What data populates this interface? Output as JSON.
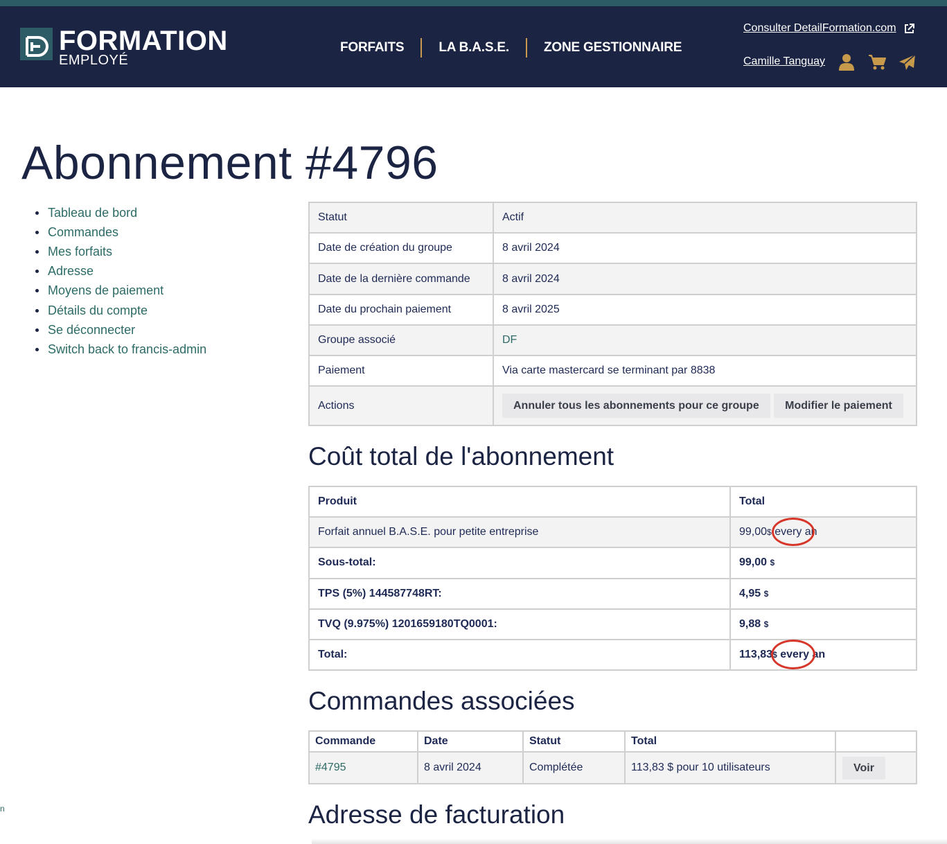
{
  "header": {
    "logo_title": "FORMATION",
    "logo_sub": "EMPLOYÉ",
    "nav": [
      "FORFAITS",
      "LA B.A.S.E.",
      "ZONE GESTIONNAIRE"
    ],
    "external_link": "Consulter DetailFormation.com",
    "user_name": "Camille Tanguay",
    "icons": [
      "user-icon",
      "cart-icon",
      "paper-plane-icon",
      "external-link-icon"
    ]
  },
  "page_title": "Abonnement #4796",
  "sidebar": {
    "items": [
      "Tableau de bord",
      "Commandes",
      "Mes forfaits",
      "Adresse",
      "Moyens de paiement",
      "Détails du compte",
      "Se déconnecter",
      "Switch back to francis-admin"
    ]
  },
  "subscription": {
    "rows": [
      {
        "label": "Statut",
        "value": "Actif"
      },
      {
        "label": "Date de création du groupe",
        "value": "8 avril 2024"
      },
      {
        "label": "Date de la dernière commande",
        "value": "8 avril 2024"
      },
      {
        "label": "Date du prochain paiement",
        "value": "8 avril 2025"
      },
      {
        "label": "Groupe associé",
        "value": "DF"
      },
      {
        "label": "Paiement",
        "value": "Via carte mastercard se terminant par 8838"
      }
    ],
    "actions_label": "Actions",
    "cancel_button": "Annuler tous les abonnements pour ce groupe",
    "modify_button": "Modifier le paiement"
  },
  "cost": {
    "heading": "Coût total de l'abonnement",
    "col_product": "Produit",
    "col_total": "Total",
    "product_name": "Forfait annuel B.A.S.E. pour petite entreprise",
    "product_amount": "99,00",
    "currency": "$",
    "recurrence": "every an",
    "subtotal_label": "Sous-total:",
    "subtotal_amount": "99,00",
    "tps_label": "TPS (5%) 144587748RT:",
    "tps_amount": "4,95",
    "tvq_label": "TVQ (9.975%) 1201659180TQ0001:",
    "tvq_amount": "9,88",
    "total_label": "Total:",
    "total_amount": "113,83"
  },
  "orders": {
    "heading": "Commandes associées",
    "columns": [
      "Commande",
      "Date",
      "Statut",
      "Total",
      ""
    ],
    "rows": [
      {
        "order": "#4795",
        "date": "8 avril 2024",
        "status": "Complétée",
        "total": "113,83 $ pour 10 utilisateurs",
        "action": "Voir"
      }
    ]
  },
  "billing_heading": "Adresse de facturation",
  "edge_text": "n",
  "colors": {
    "header_bg": "#1c2444",
    "accent_gold": "#c79a4b",
    "link_teal": "#2d6b66",
    "annotation_red": "#d7372a"
  }
}
